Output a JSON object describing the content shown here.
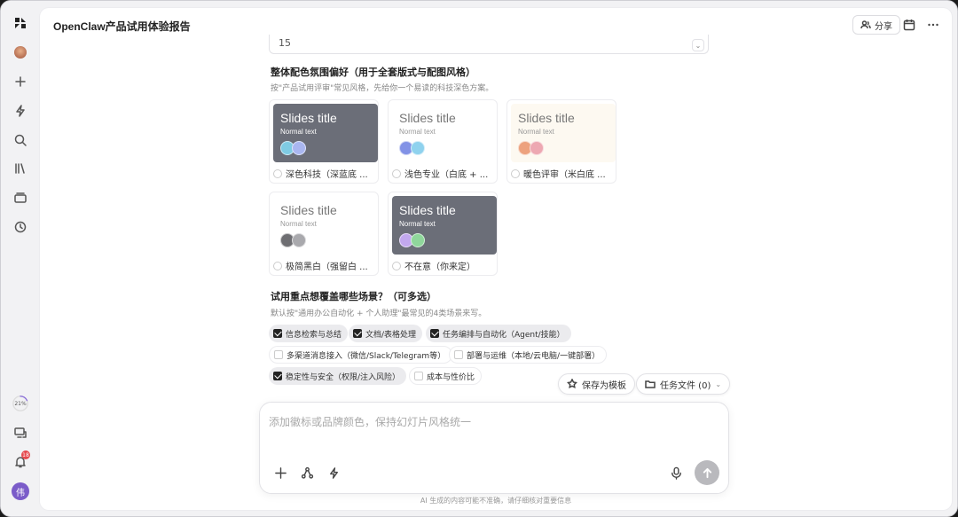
{
  "app": {
    "title": "OpenClaw产品试用体验报告"
  },
  "sidebar": {
    "progress_label": "21%",
    "notification_badge": "18",
    "avatar_letter": "伟",
    "icons": [
      "app-logo-icon",
      "user-avatar-icon",
      "new-plus-icon",
      "bolt-icon",
      "search-icon",
      "library-icon",
      "briefcase-icon",
      "history-clock-icon",
      "devices-icon",
      "bell-icon"
    ]
  },
  "topbar": {
    "share_label": "分享"
  },
  "form": {
    "select_value": "15",
    "palette_question": {
      "title": "整体配色氛围偏好（用于全套版式与配图风格）",
      "desc": "按\"产品试用评审\"常见风格，先给你一个易读的科技深色方案。",
      "options": [
        {
          "preview_title": "Slides title",
          "preview_sub": "Normal text",
          "label": "深色科技（深蓝底 ...",
          "style": "dark",
          "dots": [
            "#7fcbe3",
            "#a9b6f0"
          ]
        },
        {
          "preview_title": "Slides title",
          "preview_sub": "Normal text",
          "label": "浅色专业（白底 + ...",
          "style": "light",
          "dots": [
            "#8292e6",
            "#8fd2ee"
          ]
        },
        {
          "preview_title": "Slides title",
          "preview_sub": "Normal text",
          "label": "暖色评审（米白底 ...",
          "style": "warm",
          "dots": [
            "#eda27e",
            "#eda8b2"
          ]
        },
        {
          "preview_title": "Slides title",
          "preview_sub": "Normal text",
          "label": "极简黑白（强留白 ...",
          "style": "light",
          "dots": [
            "#6e6e72",
            "#a9a9ad"
          ]
        },
        {
          "preview_title": "Slides title",
          "preview_sub": "Normal text",
          "label": "不在意（你来定）",
          "style": "dark",
          "dots": [
            "#c2a8ee",
            "#8fd79b"
          ]
        }
      ]
    },
    "scenario_question": {
      "title": "试用重点想覆盖哪些场景？（可多选）",
      "desc": "默认按\"通用办公自动化 + 个人助理\"最常见的4类场景来写。",
      "chips": [
        {
          "label": "信息检索与总结",
          "checked": true
        },
        {
          "label": "文档/表格处理",
          "checked": true
        },
        {
          "label": "任务编排与自动化（Agent/技能）",
          "checked": true
        },
        {
          "label": "多渠道消息接入（微信/Slack/Telegram等）",
          "checked": false
        },
        {
          "label": "部署与运维（本地/云电脑/一键部署）",
          "checked": false
        },
        {
          "label": "稳定性与安全（权限/注入风险）",
          "checked": true
        },
        {
          "label": "成本与性价比",
          "checked": false
        }
      ]
    }
  },
  "actions": {
    "save_template": "保存为模板",
    "task_files": "任务文件 (0)"
  },
  "composer": {
    "placeholder": "添加徽标或品牌颜色，保持幻灯片风格统一"
  },
  "footer": {
    "disclaimer": "AI 生成的内容可能不准确，请仔细核对重要信息"
  }
}
